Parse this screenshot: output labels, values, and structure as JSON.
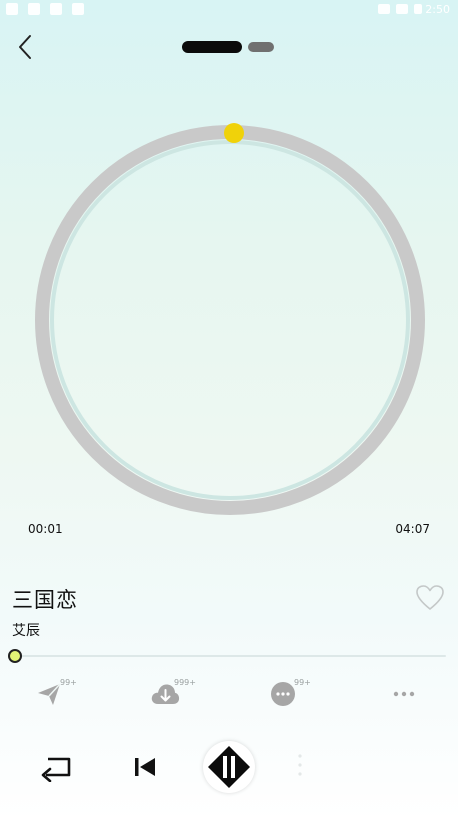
{
  "status_bar": {
    "time": "2:50"
  },
  "nav": {
    "back_icon": "chevron-left-icon",
    "pager": {
      "pages": 2,
      "active": 1
    }
  },
  "player": {
    "current_time": "00:01",
    "total_time": "04:07",
    "progress": 0.004,
    "song_title": "三国恋",
    "artist": "艾辰",
    "favorite": false
  },
  "actions": [
    {
      "name": "share",
      "icon": "send-icon",
      "count": "99+"
    },
    {
      "name": "download",
      "icon": "cloud-download-icon",
      "count": "999+"
    },
    {
      "name": "comment",
      "icon": "comment-icon",
      "count": "99+"
    },
    {
      "name": "more",
      "icon": "more-icon"
    }
  ],
  "controls": {
    "repeat_icon": "repeat-icon",
    "previous_icon": "skip-previous-icon",
    "play_pause_icon": "pause-icon"
  },
  "colors": {
    "accent": "#f0d20a",
    "ring": "#c9c9c9",
    "progress_thumb": "#e4f576"
  }
}
